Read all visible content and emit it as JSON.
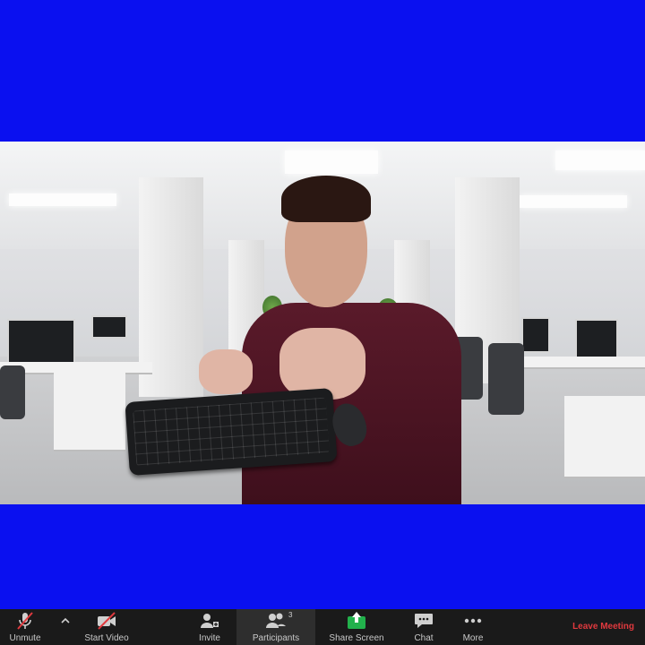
{
  "toolbar": {
    "unmute": "Unmute",
    "start_video": "Start Video",
    "invite": "Invite",
    "participants": "Participants",
    "participants_count": "3",
    "share_screen": "Share Screen",
    "chat": "Chat",
    "more": "More",
    "leave_meeting": "Leave Meeting"
  },
  "colors": {
    "background": "#0a10f0",
    "toolbar": "#1a1a1a",
    "share_icon": "#22b14c",
    "leave": "#e0393e",
    "muted_slash": "#e0393e"
  },
  "icons": [
    "microphone-muted-icon",
    "chevron-up-icon",
    "video-off-icon",
    "add-person-icon",
    "participants-icon",
    "share-screen-icon",
    "chat-icon",
    "more-icon"
  ]
}
